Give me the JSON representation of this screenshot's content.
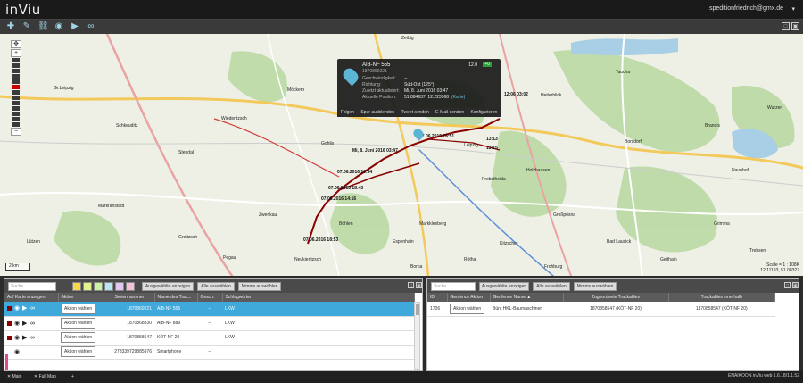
{
  "app": {
    "title": "inViu",
    "user": "speditionfriedrich@gmx.de",
    "user_caret": "▾"
  },
  "toolbar_icons": [
    "plus-icon",
    "pencil-icon",
    "chain-icon",
    "eye-icon",
    "play-icon",
    "link-icon"
  ],
  "map": {
    "zoom_plus": "+",
    "zoom_minus": "−",
    "scale_label": "2 km",
    "coords_line1": "Scale = 1 : 108K",
    "coords_line2": "12.11193, 51.08327",
    "labels": [
      "Zeibig",
      "Möckern",
      "Stendal",
      "Gr.Leipzig",
      "Wiederitzsch",
      "Heiterblick",
      "Gohlis",
      "Leipzig",
      "Probstheida",
      "Holzhausen",
      "Markkleeberg",
      "Großpösna",
      "Zwenkau",
      "Rötha",
      "Naunhof",
      "Brandis",
      "Borsdorf",
      "Taucha",
      "Schkeuditz",
      "Markranstädt",
      "Lützen",
      "Pegau",
      "Groitzsch",
      "Böhlen",
      "Espenhain",
      "Neukieritzsch",
      "Kitzscher",
      "Frohburg",
      "Borna",
      "Geithain",
      "Bad Lausick",
      "Grimma",
      "Trebsen",
      "Wurzen"
    ],
    "track_points": [
      "07.06.2016 18:53",
      "07.06.2016 18:43",
      "07.06.2016 16:34",
      "07.06.2016 14:16",
      "Mi, 8. Juni 2016 03:47",
      "07.06.2016 16:51",
      "13:13",
      "13:15",
      "12:06 03:02"
    ]
  },
  "popup": {
    "title": "AIB-NF 555",
    "serial": "1870869221",
    "badge_num": "12.0",
    "badge": "+0",
    "rows": [
      {
        "label": "Geschwindigkeit:",
        "value": "--"
      },
      {
        "label": "Richtung:",
        "value": "Süd-Ost (125°)"
      },
      {
        "label": "Zuletzt aktualisiert:",
        "value": "Mi, 8. Juni 2016 03:47"
      },
      {
        "label": "Aktuelle Position:",
        "value": "51.884937, 12.223968"
      }
    ],
    "karte_link": "(Karte)",
    "actions": [
      "Folgen",
      "Spur ausblenden",
      "Tweet senden",
      "E-Mail senden",
      "Konfigurieren"
    ]
  },
  "left_panel": {
    "search_placeholder": "Suche",
    "swatch_colors": [
      "#f7d84a",
      "#e6f28c",
      "#c9f2a3",
      "#b8e6f2",
      "#e0c8f2",
      "#f2c2d8"
    ],
    "buttons": [
      "Ausgewählte anzeigen",
      "Alle auswählen",
      "Nimms auswählen"
    ],
    "columns": [
      "Auf Karte anzeigen",
      "Aktion",
      "Seriennummer",
      "Name des Trac...",
      "Gesch.",
      "Schlagwörter"
    ],
    "rows": [
      {
        "action": "Aktion wählen",
        "serial": "1870869221",
        "name": "AIB-NF 555",
        "speed": "--",
        "tags": "LKW"
      },
      {
        "action": "Aktion wählen",
        "serial": "1870868830",
        "name": "AIB-NF 889",
        "speed": "--",
        "tags": "LKW"
      },
      {
        "action": "Aktion wählen",
        "serial": "1870858547",
        "name": "KÖT-NF 20",
        "speed": "--",
        "tags": "LKW"
      },
      {
        "action": "Aktion wählen",
        "serial": "273339729885976",
        "name": "Smartphone",
        "speed": "--",
        "tags": ""
      }
    ],
    "row_colors": [
      "#3fa9dc",
      "#ffffff",
      "#ffffff",
      "#e04c8e"
    ]
  },
  "right_panel": {
    "search_placeholder": "Suche",
    "buttons": [
      "Ausgewählte anzeigen",
      "Alle auswählen",
      "Nimms auswählen"
    ],
    "columns": [
      "ID",
      "Geofence Aktion",
      "Geofence Name ▲",
      "Zugeordnete Trackables",
      "Trackables innerhalb"
    ],
    "rows": [
      {
        "id": "1706",
        "action": "Aktion wählen",
        "name": "Bünt HKL-Baumaschinen",
        "assigned": "1870858547 (KÖT-NF 20)",
        "inside": "1870858547 (KÖT-NF 20)"
      }
    ]
  },
  "bottom": {
    "tabs": [
      "Main",
      "Full Map",
      "+"
    ],
    "version": "ENAIKOON inViu web 1.6.18/1.1.52"
  },
  "colors": {
    "accent": "#3fa9dc",
    "track": "#8b0000",
    "route": "#d03a3a"
  }
}
